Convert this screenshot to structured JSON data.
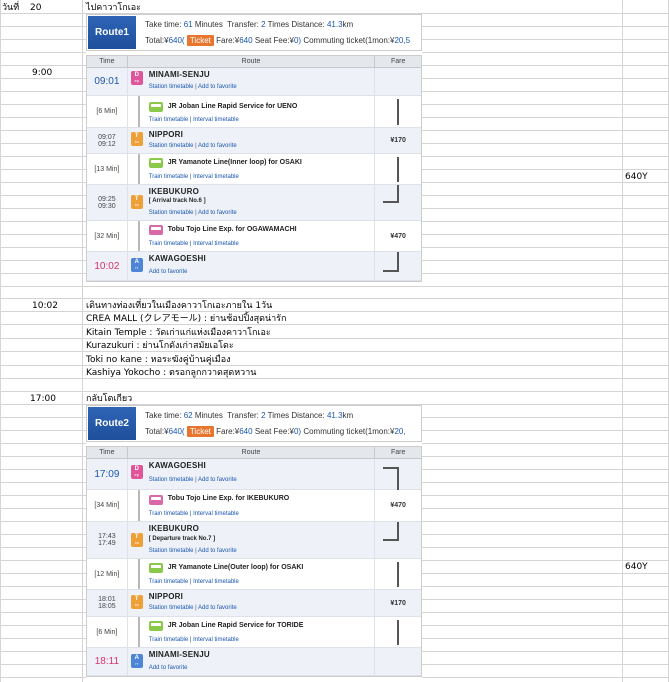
{
  "sheet": {
    "day_label": "วันที่",
    "day_number": "20",
    "row1_title": "ไปคาวาโกเอะ",
    "time_900": "9:00",
    "time_1002": "10:02",
    "time_1700": "17:00",
    "fare_total_1": "640Y",
    "fare_total_2": "640Y",
    "return_title": "กลับโตเกียว",
    "activities": [
      "เดินทางท่องเที่ยวในเมืองคาวาโกเอะภายใน   1วัน",
      "CREA MALL (クレアモール) : ย่านช้อปปิ้งสุดน่ารัก",
      "Kitain Temple : วัดเก่าแก่แห่งเมืองคาวาโกเอะ",
      "Kurazukuri : ย่านโกดังเก่าสมัยเอโดะ",
      "Toki no kane : หอระฆังคู่บ้านคู่เมือง",
      "Kashiya Yokocho : ตรอกลูกกวาดสุดหวาน"
    ]
  },
  "routes": [
    {
      "badge": "Route1",
      "summary": {
        "take_time_label": "Take time:",
        "take_time": "61",
        "minutes": "Minutes",
        "transfer_label": "Transfer:",
        "transfer": "2",
        "times": "Times",
        "distance_label": "Distance:",
        "distance": "41.3",
        "km": "km",
        "total_label": "Total:¥",
        "total": "640(",
        "ticket": "Ticket",
        "fare_label": "Fare:¥",
        "fare": "640",
        "seat_label": "Seat Fee:¥",
        "seat": "0)",
        "commuting_label": "Commuting ticket(1mon:¥",
        "commuting": "20,5"
      },
      "headers": {
        "time": "Time",
        "route": "Route",
        "fare": "Fare"
      },
      "stations": [
        {
          "time": "09:01",
          "icon_top": "D",
          "icon_bottom": "ep",
          "name": "MINAMI-SENJU",
          "links": [
            "Station timetable",
            "Add to favorite"
          ]
        },
        {
          "time_a": "09:07",
          "time_b": "09:12",
          "icon_top": "T",
          "icon_bottom": "ra",
          "name": "NIPPORI",
          "links": [
            "Station timetable",
            "Add to favorite"
          ],
          "fare": "¥170"
        },
        {
          "time_a": "09:25",
          "time_b": "09:30",
          "icon_top": "T",
          "icon_bottom": "ra",
          "name": "IKEBUKURO",
          "track": "[ Arrival track No.6 ]",
          "links": [
            "Station timetable",
            "Add to favorite"
          ]
        },
        {
          "time": "10:02",
          "icon_top": "A",
          "icon_bottom": "rr",
          "name": "KAWAGOESHI",
          "links": [
            "Add to favorite"
          ]
        }
      ],
      "lines": [
        {
          "duration": "[6 Min]",
          "name": "JR Joban Line Rapid Service  for UENO",
          "links": [
            "Train timetable",
            "Interval timetable"
          ]
        },
        {
          "duration": "[13 Min]",
          "name": "JR Yamanote Line(Inner loop)  for OSAKI",
          "links": [
            "Train timetable",
            "Interval timetable"
          ]
        },
        {
          "duration": "[32 Min]",
          "name": "Tobu Tojo Line Exp.  for OGAWAMACHI",
          "links": [
            "Train timetable",
            "Interval timetable"
          ],
          "fare": "¥470"
        }
      ]
    },
    {
      "badge": "Route2",
      "summary": {
        "take_time_label": "Take time:",
        "take_time": "62",
        "minutes": "Minutes",
        "transfer_label": "Transfer:",
        "transfer": "2",
        "times": "Times",
        "distance_label": "Distance:",
        "distance": "41.3",
        "km": "km",
        "total_label": "Total:¥",
        "total": "640(",
        "ticket": "Ticket",
        "fare_label": "Fare:¥",
        "fare": "640",
        "seat_label": "Seat Fee:¥",
        "seat": "0)",
        "commuting_label": "Commuting ticket(1mon:¥",
        "commuting": "20,"
      },
      "headers": {
        "time": "Time",
        "route": "Route",
        "fare": "Fare"
      },
      "stations": [
        {
          "time": "17:09",
          "icon_top": "D",
          "icon_bottom": "ep",
          "name": "KAWAGOESHI",
          "links": [
            "Station timetable",
            "Add to favorite"
          ]
        },
        {
          "time_a": "17:43",
          "time_b": "17:49",
          "icon_top": "T",
          "icon_bottom": "ra",
          "name": "IKEBUKURO",
          "track": "[ Departure track No.7 ]",
          "links": [
            "Station timetable",
            "Add to favorite"
          ]
        },
        {
          "time_a": "18:01",
          "time_b": "18:05",
          "icon_top": "T",
          "icon_bottom": "ra",
          "name": "NIPPORI",
          "links": [
            "Station timetable",
            "Add to favorite"
          ],
          "fare": "¥170"
        },
        {
          "time": "18:11",
          "icon_top": "A",
          "icon_bottom": "rr",
          "name": "MINAMI-SENJU",
          "links": [
            "Add to favorite"
          ]
        }
      ],
      "lines": [
        {
          "duration": "[34 Min]",
          "name": "Tobu Tojo Line Exp.  for IKEBUKURO",
          "links": [
            "Train timetable",
            "Interval timetable"
          ],
          "fare": "¥470"
        },
        {
          "duration": "[12 Min]",
          "name": "JR Yamanote Line(Outer loop)  for OSAKI",
          "links": [
            "Train timetable",
            "Interval timetable"
          ]
        },
        {
          "duration": "[6 Min]",
          "name": "JR Joban Line Rapid Service  for TORIDE",
          "links": [
            "Train timetable",
            "Interval timetable"
          ]
        }
      ]
    }
  ]
}
